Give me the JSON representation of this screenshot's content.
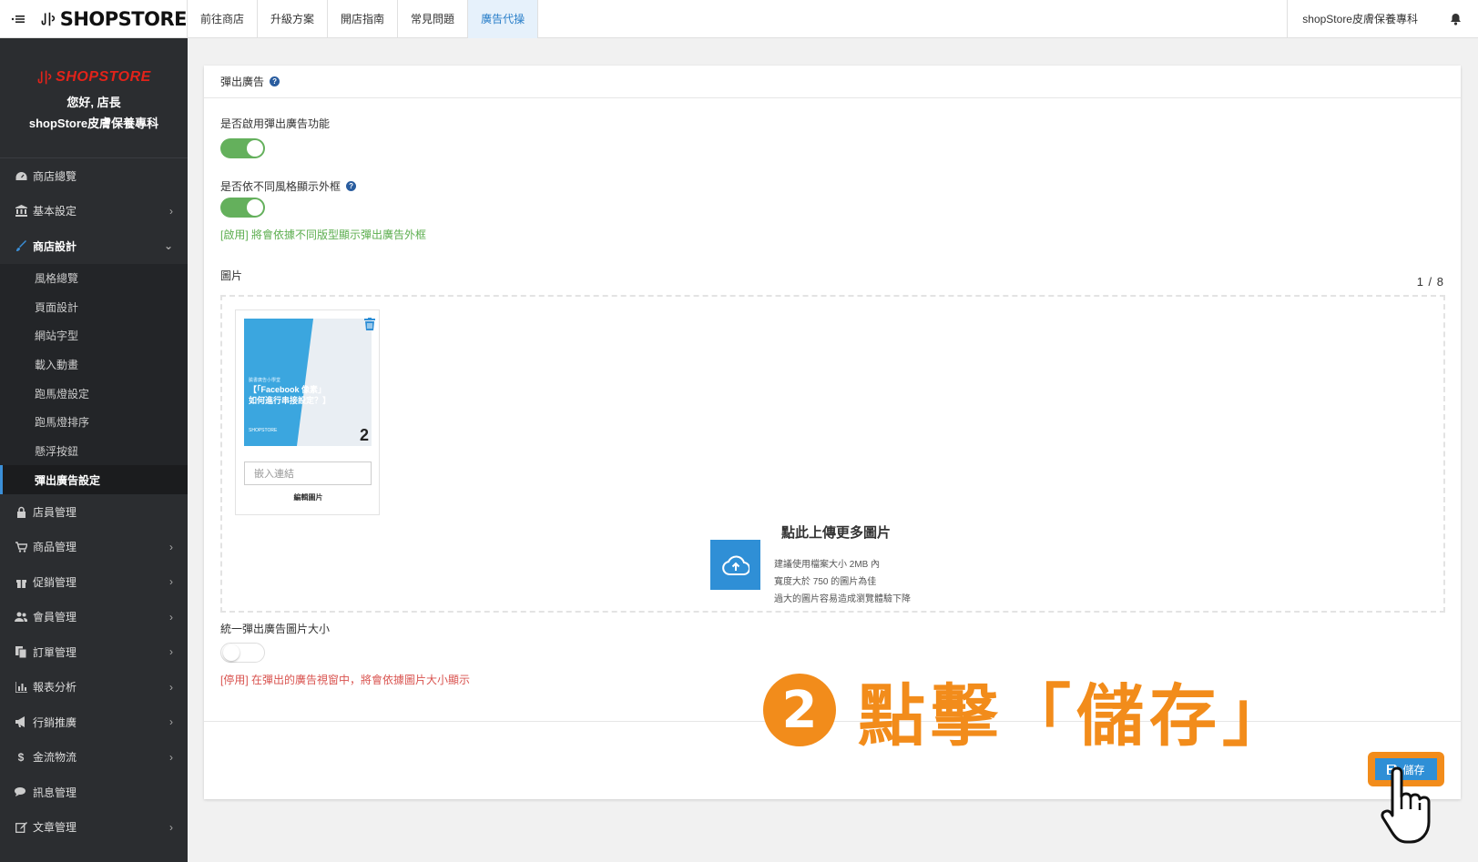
{
  "topbar": {
    "menu_icon": "menu-icon",
    "logo_text": "SHOPSTORE",
    "nav": [
      "前往商店",
      "升級方案",
      "開店指南",
      "常見問題",
      "廣告代操"
    ],
    "active_nav": 4,
    "store_name": "shopStore皮膚保養專科",
    "bell_icon": "bell-icon"
  },
  "sidebar": {
    "logo_text": "SHOPSTORE",
    "greeting": "您好, 店長",
    "store": "shopStore皮膚保養專科",
    "items_top": [
      {
        "label": "商店總覽",
        "icon": "dashboard-icon",
        "chevron": false
      },
      {
        "label": "基本設定",
        "icon": "bank-icon",
        "chevron": true
      },
      {
        "label": "商店設計",
        "icon": "brush-icon",
        "chevron": true,
        "open": true
      }
    ],
    "subitems": [
      "風格總覽",
      "頁面設計",
      "網站字型",
      "載入動畫",
      "跑馬燈設定",
      "跑馬燈排序",
      "懸浮按鈕",
      "彈出廣告設定"
    ],
    "active_sub": 7,
    "items_bottom": [
      {
        "label": "店員管理",
        "icon": "lock-icon",
        "chevron": false
      },
      {
        "label": "商品管理",
        "icon": "cart-icon",
        "chevron": true
      },
      {
        "label": "促銷管理",
        "icon": "gift-icon",
        "chevron": true
      },
      {
        "label": "會員管理",
        "icon": "users-icon",
        "chevron": true
      },
      {
        "label": "訂單管理",
        "icon": "copy-icon",
        "chevron": true
      },
      {
        "label": "報表分析",
        "icon": "chart-icon",
        "chevron": true
      },
      {
        "label": "行銷推廣",
        "icon": "bullhorn-icon",
        "chevron": true
      },
      {
        "label": "金流物流",
        "icon": "dollar-icon",
        "chevron": true
      },
      {
        "label": "訊息管理",
        "icon": "comments-icon",
        "chevron": false
      },
      {
        "label": "文章管理",
        "icon": "edit-icon",
        "chevron": true
      }
    ]
  },
  "card": {
    "title": "彈出廣告",
    "enable_label": "是否啟用彈出廣告功能",
    "enable_on": true,
    "frame_label": "是否依不同風格顯示外框",
    "frame_on": true,
    "frame_hint": "[啟用] 將會依據不同版型顯示彈出廣告外框",
    "images_label": "圖片",
    "images_count": "1 / 8",
    "thumb": {
      "small_text": "臉書廣告小學堂",
      "title_line1": "【「Facebook 像素」",
      "title_line2": "如何進行串接設定？】",
      "brand": "SHOPSTORE",
      "number": "2",
      "embed_placeholder": "嵌入連結",
      "edit_label": "編輯圖片"
    },
    "upload": {
      "title": "點此上傳更多圖片",
      "line1": "建議使用檔案大小 2MB 內",
      "line2": "寬度大於 750 的圖片為佳",
      "line3": "過大的圖片容易造成瀏覽體驗下降"
    },
    "unify_label": "統一彈出廣告圖片大小",
    "unify_on": false,
    "unify_hint": "[停用] 在彈出的廣告視窗中，將會依據圖片大小顯示",
    "save_label": "儲存"
  },
  "annotation": {
    "number": "2",
    "text": "點擊「儲存」"
  },
  "colors": {
    "accent": "#2f8fd6",
    "annotation": "#f28c1b",
    "toggle_on": "#64b05c",
    "sidebar_bg": "#2b2d30"
  }
}
